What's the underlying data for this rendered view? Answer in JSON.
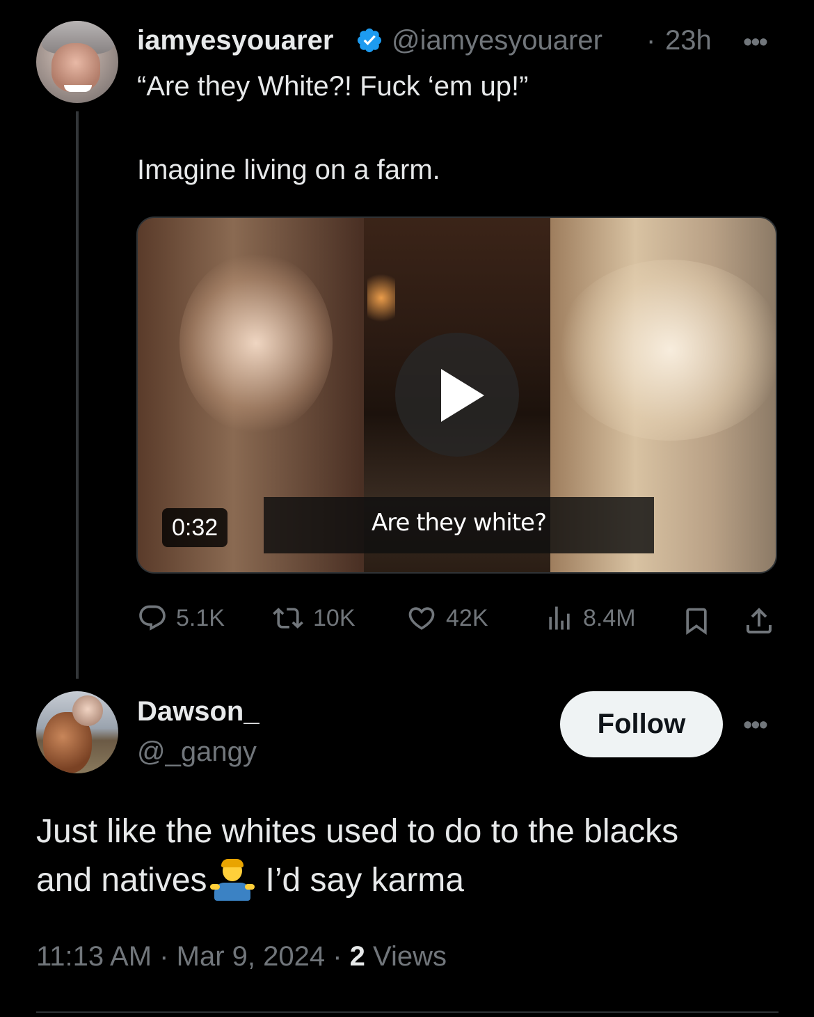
{
  "tweet": {
    "author_name": "iamyesyouarer",
    "handle": "@iamyesyouarer",
    "separator": "·",
    "time": "23h",
    "text_line1": "“Are they White?! Fuck ‘em up!”",
    "text_line2": "Imagine living on a farm.",
    "video": {
      "duration": "0:32",
      "caption": "Are they white?"
    },
    "stats": {
      "replies": "5.1K",
      "retweets": "10K",
      "likes": "42K",
      "views": "8.4M"
    }
  },
  "reply": {
    "author_name": "Dawson_",
    "handle": "@_gangy",
    "follow_label": "Follow",
    "text_line1": "Just like the whites used to do to the blacks",
    "text_line2_a": "and natives",
    "emoji": "person-shrugging",
    "text_line2_b": "I’d say karma",
    "meta": {
      "time": "11:13 AM",
      "dot1": "·",
      "date": "Mar 9, 2024",
      "dot2": "·",
      "views_count": "2",
      "views_label": "Views"
    }
  },
  "colors": {
    "background": "#000000",
    "text": "#e7e9ea",
    "muted": "#71767b",
    "verified": "#1d9bf0",
    "follow_bg": "#eff3f4"
  }
}
